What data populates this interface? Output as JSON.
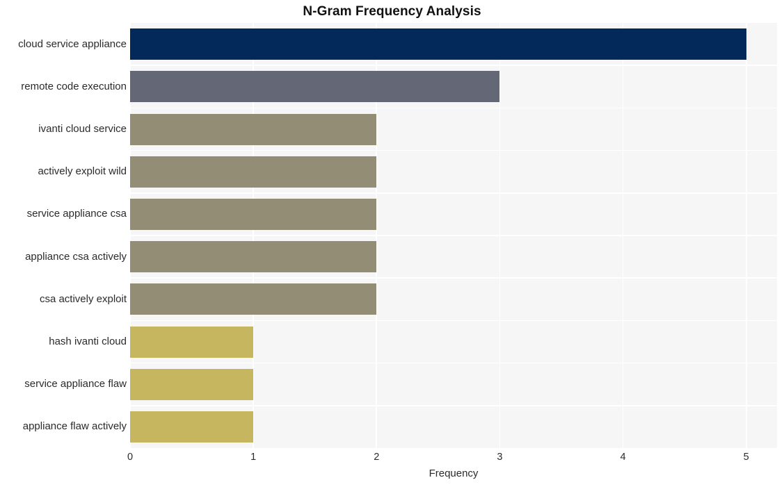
{
  "chart_data": {
    "type": "bar",
    "orientation": "horizontal",
    "title": "N-Gram Frequency Analysis",
    "xlabel": "Frequency",
    "ylabel": "",
    "xlim": [
      0,
      5.25
    ],
    "xticks": [
      "0",
      "1",
      "2",
      "3",
      "4",
      "5"
    ],
    "xtick_values": [
      0,
      1,
      2,
      3,
      4,
      5
    ],
    "grid": true,
    "grid_color": "#ffffff",
    "plot_background": "#f6f6f7",
    "legend": null,
    "categories": [
      "cloud service appliance",
      "remote code execution",
      "ivanti cloud service",
      "actively exploit wild",
      "service appliance csa",
      "appliance csa actively",
      "csa actively exploit",
      "hash ivanti cloud",
      "service appliance flaw",
      "appliance flaw actively"
    ],
    "values": [
      5,
      3,
      2,
      2,
      2,
      2,
      2,
      1,
      1,
      1
    ],
    "bar_colors": [
      "#03285a",
      "#646876",
      "#938d76",
      "#938d76",
      "#938d76",
      "#938d76",
      "#938d76",
      "#c7b660",
      "#c7b660",
      "#c7b660"
    ]
  },
  "colors": {
    "navy": "#03285a",
    "slate": "#646876",
    "olive": "#938d76",
    "gold": "#c7b660",
    "plot_bg": "#f6f6f7",
    "grid": "#ffffff",
    "text": "#2b2b2b",
    "title": "#111111"
  }
}
